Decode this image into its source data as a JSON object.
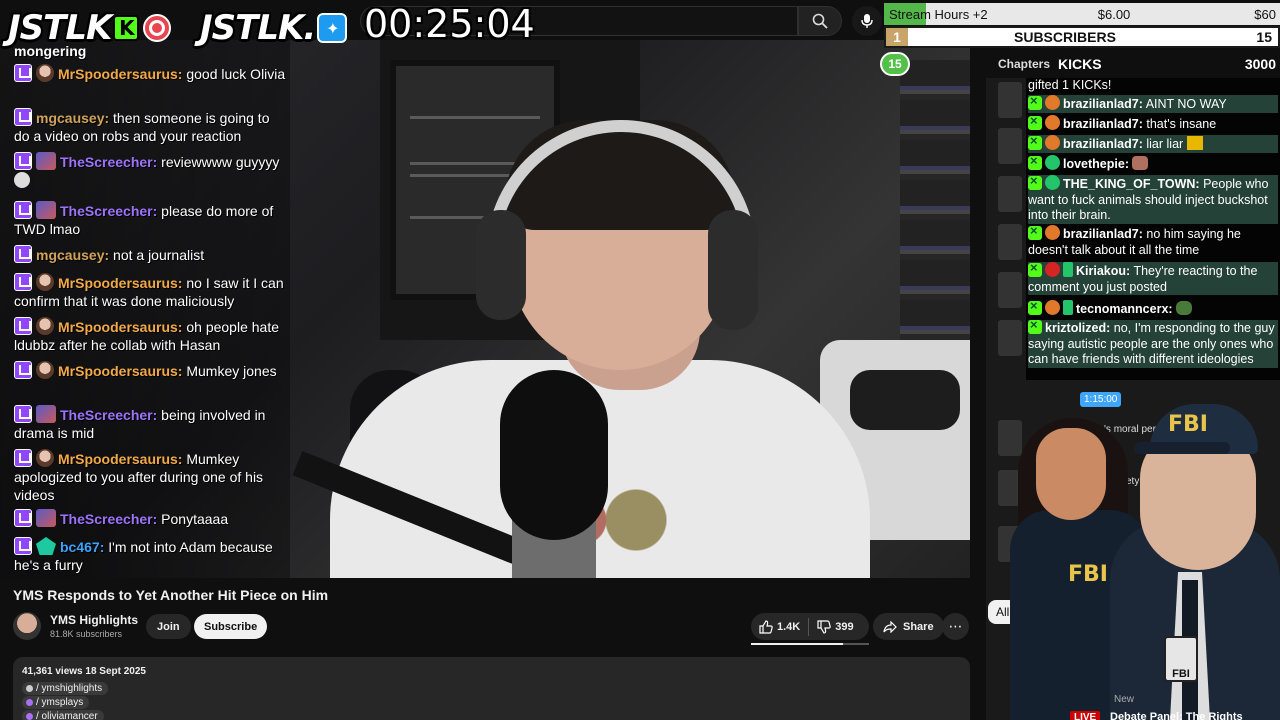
{
  "overlay": {
    "kick_logo_text": "JSTLK",
    "kick_badge": "K",
    "twitter_logo_text": "JSTLK.",
    "timer": "00:25:04"
  },
  "left_chat": [
    {
      "user": "",
      "text": "mongering",
      "color": "#ffffff"
    },
    {
      "user": "MrSpoodersaurus:",
      "text": "good luck Olivia",
      "color": "#f3a948"
    },
    {
      "user": "mgcausey:",
      "text": "then someone is going to do a video on robs and your reaction",
      "color": "#d1a35a"
    },
    {
      "user": "TheScreecher:",
      "text": "reviewwww guyyyy",
      "color": "#9d72ff"
    },
    {
      "user": "TheScreecher:",
      "text": "please do more of TWD lmao",
      "color": "#9d72ff"
    },
    {
      "user": "mgcausey:",
      "text": "not a journalist",
      "color": "#d1a35a"
    },
    {
      "user": "MrSpoodersaurus:",
      "text": "no I saw it I can confirm that it was done maliciously",
      "color": "#f3a948"
    },
    {
      "user": "MrSpoodersaurus:",
      "text": "oh people hate ldubbz after he collab with Hasan",
      "color": "#f3a948"
    },
    {
      "user": "MrSpoodersaurus:",
      "text": "Mumkey jones",
      "color": "#f3a948"
    },
    {
      "user": "TheScreecher:",
      "text": "being involved in drama is mid",
      "color": "#9d72ff"
    },
    {
      "user": "MrSpoodersaurus:",
      "text": "Mumkey apologized to you after during one of his videos",
      "color": "#f3a948"
    },
    {
      "user": "TheScreecher:",
      "text": "Ponytaaaa",
      "color": "#9d72ff"
    },
    {
      "user": "bc467:",
      "text": "I'm not into Adam because he's a furry",
      "color": "#3aa2ff"
    }
  ],
  "stats": {
    "stream_hours_label": "Stream Hours +2",
    "stream_hours_amount": "$6.00",
    "stream_hours_goal": "$60",
    "subs_rank": "1",
    "subs_label": "SUBSCRIBERS",
    "subs_count": "15",
    "kicks_badge": "15",
    "chapters_label": "Chapters",
    "kicks_label": "KICKS",
    "kicks_count": "3000"
  },
  "right_chat": [
    {
      "user": "",
      "text": "gifted 1 KICKs!",
      "badge": "none",
      "hl": false
    },
    {
      "user": "brazilianlad7:",
      "text": "AINT NO WAY",
      "badge": "orange",
      "hl": true
    },
    {
      "user": "brazilianlad7:",
      "text": "that's insane",
      "badge": "orange",
      "hl": false
    },
    {
      "user": "brazilianlad7:",
      "text": "liar liar",
      "badge": "orange",
      "hl": true
    },
    {
      "user": "lovethepie:",
      "text": "",
      "badge": "green",
      "hl": false
    },
    {
      "user": "THE_KING_OF_TOWN:",
      "text": "People who want to fuck animals should inject buckshot into their brain.",
      "badge": "green",
      "hl": true
    },
    {
      "user": "brazilianlad7:",
      "text": "no him saying he doesn't talk about it all the time",
      "badge": "orange",
      "hl": false
    },
    {
      "user": "Kiriakou:",
      "text": "They're reacting to the comment you just posted",
      "badge": "red",
      "hl": true
    },
    {
      "user": "tecnomanncerx:",
      "text": "",
      "badge": "orange",
      "hl": false
    },
    {
      "user": "kriztolized:",
      "text": "no, I'm responding to the guy saying autistic people are the only ones who can have friends with different ideologies",
      "badge": "none",
      "hl": true
    }
  ],
  "sidebar": {
    "time": "1:15:00",
    "snippet1": "'s moral per",
    "snippet2": "ety co",
    "chip": "All",
    "new_label": "New",
    "live_label": "LIVE",
    "debate_title": "Debate Panel: The Rights"
  },
  "fbi": {
    "woman_tag": "FBI",
    "man_tag": "FBI",
    "badge_tag": "FBI"
  },
  "video": {
    "title": "YMS Responds to Yet Another Hit Piece on Him",
    "channel": "YMS Highlights",
    "subscribers": "81.8K subscribers",
    "join": "Join",
    "subscribe": "Subscribe",
    "likes": "1.4K",
    "dislikes": "399",
    "like_ratio": 0.78,
    "share": "Share",
    "more": "⋯",
    "views_date": "41,361 views  18 Sept 2025",
    "links": [
      "/ ymshighlights",
      "/ ymsplays",
      "/ oliviamancer"
    ]
  },
  "colors": {
    "kick_green": "#53fc18",
    "twitch_purple": "#9146ff",
    "youtube_bg": "#0f0f0f"
  }
}
